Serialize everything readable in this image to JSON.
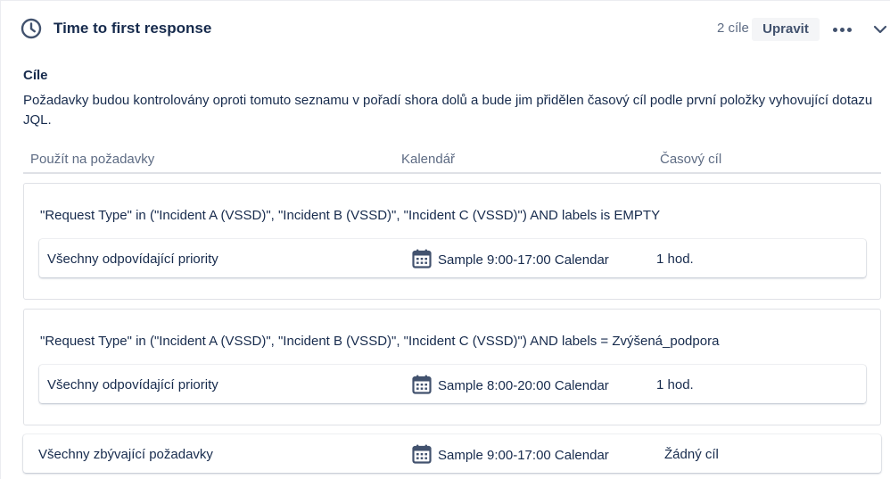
{
  "header": {
    "icon": "clock-icon",
    "title": "Time to first response",
    "goal_count": "2 cíle",
    "edit_label": "Upravit",
    "more_icon": "more-horizontal-icon",
    "collapse_icon": "chevron-down-icon"
  },
  "goals": {
    "label": "Cíle",
    "description": "Požadavky budou kontrolovány oproti tomuto seznamu v pořadí shora dolů a bude jim přidělen časový cíl podle první položky vyhovující dotazu JQL.",
    "columns": [
      "Použít na požadavky",
      "Kalendář",
      "Časový cíl"
    ],
    "rules": [
      {
        "jql": "\"Request Type\" in (\"Incident A (VSSD)\", \"Incident B (VSSD)\", \"Incident C (VSSD)\") AND labels is EMPTY",
        "priority": "Všechny odpovídající priority",
        "calendar_icon": "calendar-icon",
        "calendar": "Sample 9:00-17:00 Calendar",
        "target": "1 hod."
      },
      {
        "jql": "\"Request Type\" in (\"Incident A (VSSD)\", \"Incident B (VSSD)\", \"Incident C (VSSD)\") AND labels = Zvýšená_podpora",
        "priority": "Všechny odpovídající priority",
        "calendar_icon": "calendar-icon",
        "calendar": "Sample 8:00-20:00 Calendar",
        "target": "1 hod."
      }
    ],
    "remaining": {
      "label": "Všechny zbývající požadavky",
      "calendar_icon": "calendar-icon",
      "calendar": "Sample 9:00-17:00 Calendar",
      "target": "Žádný cíl"
    }
  },
  "colors": {
    "text": "#172b4d",
    "subtle": "#5e6c84",
    "border": "#dfe1e6",
    "icon": "#42526e",
    "button_bg": "#f4f5f7"
  }
}
